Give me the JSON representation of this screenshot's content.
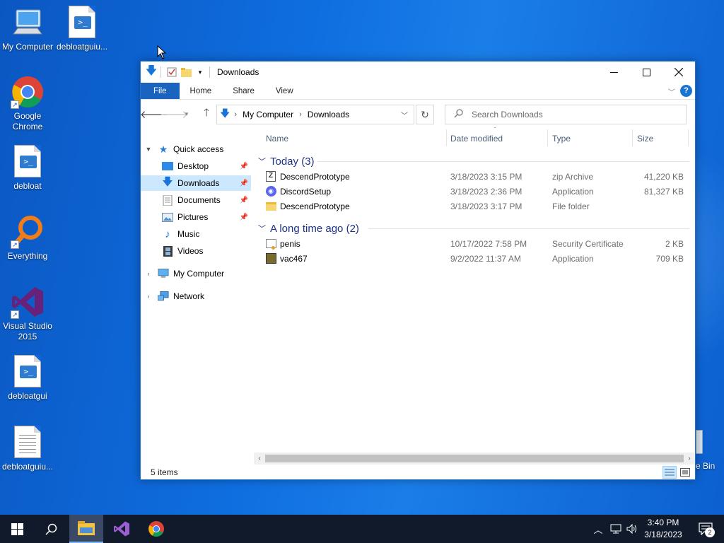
{
  "desktop": {
    "icons": [
      {
        "label": "My Computer"
      },
      {
        "label": "debloatguiu..."
      },
      {
        "label": "Google Chrome"
      },
      {
        "label": "debloat"
      },
      {
        "label": "Everything"
      },
      {
        "label": "Visual Studio 2015"
      },
      {
        "label": "debloatgui"
      },
      {
        "label": "debloatguiu..."
      }
    ],
    "recycle_bin_partial_label": "e Bin"
  },
  "window": {
    "title": "Downloads",
    "ribbon_tabs": [
      "File",
      "Home",
      "Share",
      "View"
    ],
    "help_label": "?",
    "address": {
      "crumbs": [
        "My Computer",
        "Downloads"
      ]
    },
    "search": {
      "placeholder": "Search Downloads"
    },
    "nav": {
      "quick_access": "Quick access",
      "items": [
        "Desktop",
        "Downloads",
        "Documents",
        "Pictures",
        "Music",
        "Videos"
      ],
      "my_computer": "My Computer",
      "network": "Network"
    },
    "columns": {
      "name": "Name",
      "date": "Date modified",
      "type": "Type",
      "size": "Size"
    },
    "groups": [
      {
        "label": "Today (3)",
        "files": [
          {
            "name": "DescendPrototype",
            "date": "3/18/2023 3:15 PM",
            "type": "zip Archive",
            "size": "41,220 KB",
            "icon": "zip-icon"
          },
          {
            "name": "DiscordSetup",
            "date": "3/18/2023 2:36 PM",
            "type": "Application",
            "size": "81,327 KB",
            "icon": "discord-icon"
          },
          {
            "name": "DescendPrototype",
            "date": "3/18/2023 3:17 PM",
            "type": "File folder",
            "size": "",
            "icon": "folder-icon"
          }
        ]
      },
      {
        "label": "A long time ago (2)",
        "files": [
          {
            "name": "penis",
            "date": "10/17/2022 7:58 PM",
            "type": "Security Certificate",
            "size": "2 KB",
            "icon": "certificate-icon"
          },
          {
            "name": "vac467",
            "date": "9/2/2022 11:37 AM",
            "type": "Application",
            "size": "709 KB",
            "icon": "exe-icon"
          }
        ]
      }
    ],
    "status": {
      "count": "5 items"
    }
  },
  "taskbar": {
    "clock_time": "3:40 PM",
    "clock_date": "3/18/2023",
    "notification_count": "2"
  }
}
